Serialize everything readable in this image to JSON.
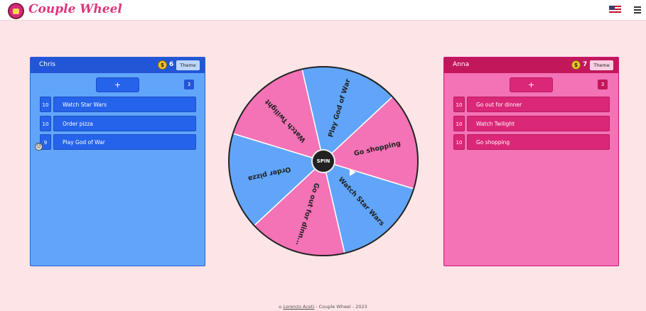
{
  "app": {
    "title": "Couple Wheel"
  },
  "header": {
    "language_flag": "us-flag-icon",
    "menu_icon": "hamburger-menu-icon"
  },
  "players": {
    "left": {
      "name": "Chris",
      "coins": "6",
      "theme_label": "Theme",
      "add_label": "+",
      "count": "3",
      "items": [
        {
          "weight": "10",
          "label": "Watch Star Wars"
        },
        {
          "weight": "10",
          "label": "Order pizza"
        },
        {
          "weight": "9",
          "label": "Play God of War"
        }
      ],
      "color": "#60a5fa"
    },
    "right": {
      "name": "Anna",
      "coins": "7",
      "theme_label": "Theme",
      "add_label": "+",
      "count": "3",
      "items": [
        {
          "weight": "10",
          "label": "Go out for dinner"
        },
        {
          "weight": "10",
          "label": "Watch Twilight"
        },
        {
          "weight": "10",
          "label": "Go shopping"
        }
      ],
      "color": "#f472b6"
    }
  },
  "wheel": {
    "spin_label": "SPIN",
    "segments": [
      {
        "label": "Watch Twilight",
        "color": "#f472b6"
      },
      {
        "label": "Play God of War",
        "color": "#60a5fa"
      },
      {
        "label": "Go shopping",
        "color": "#f472b6"
      },
      {
        "label": "Watch Star Wars",
        "color": "#60a5fa"
      },
      {
        "label": "Go out for dinn...",
        "color": "#f472b6"
      },
      {
        "label": "Order pizza",
        "color": "#60a5fa"
      }
    ]
  },
  "footer": {
    "author": "Lorenzo Aceti",
    "text": " - Couple Wheel - 2023"
  }
}
